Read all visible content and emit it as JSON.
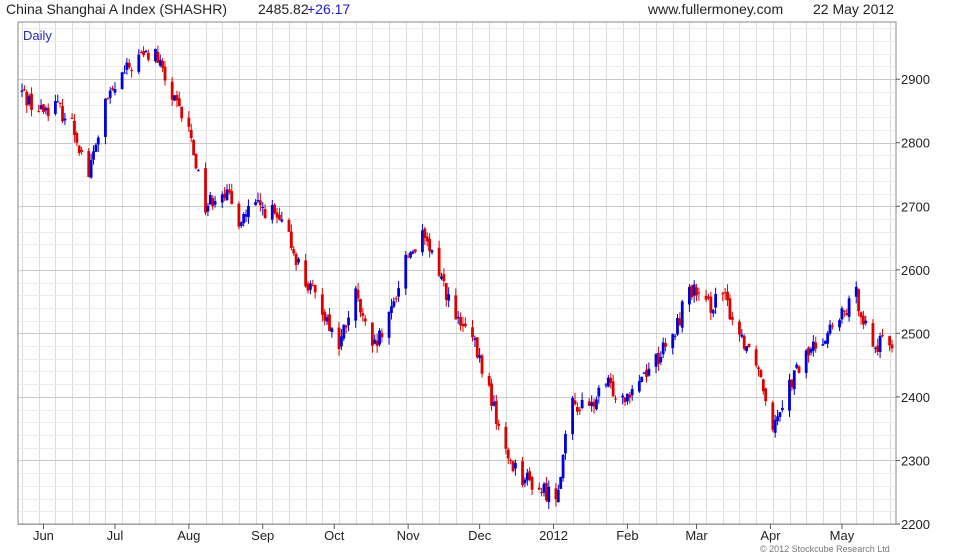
{
  "header": {
    "title": "China Shanghai A Index (SHASHR)",
    "last": "2485.82",
    "change": "+26.17",
    "site": "www.fullermoney.com",
    "date": "22 May 2012"
  },
  "footer": {
    "credit": "© 2012 Stockcube Research Ltd"
  },
  "colors": {
    "up": "#0000dd",
    "down": "#dd0000",
    "grid": "#dcdcdc",
    "frame": "#888888",
    "periodLabel": "#2a2ab0"
  },
  "chart_data": {
    "type": "candlestick",
    "title": "China Shanghai A Index (SHASHR)",
    "period_label": "Daily",
    "xlabel": "",
    "ylabel": "",
    "ylim": [
      2200,
      2990
    ],
    "yticks": [
      2200,
      2300,
      2400,
      2500,
      2600,
      2700,
      2800,
      2900
    ],
    "y_axis_side": "right",
    "grid": true,
    "xlim": [
      "2011-05-23",
      "2012-05-22"
    ],
    "x_ticks": [
      {
        "label": "Jun",
        "date": "2011-06-01"
      },
      {
        "label": "Jul",
        "date": "2011-07-01"
      },
      {
        "label": "Aug",
        "date": "2011-08-01"
      },
      {
        "label": "Sep",
        "date": "2011-09-01"
      },
      {
        "label": "Oct",
        "date": "2011-10-01"
      },
      {
        "label": "Nov",
        "date": "2011-11-01"
      },
      {
        "label": "Dec",
        "date": "2011-12-01"
      },
      {
        "label": "2012",
        "date": "2012-01-01"
      },
      {
        "label": "Feb",
        "date": "2012-02-01"
      },
      {
        "label": "Mar",
        "date": "2012-03-01"
      },
      {
        "label": "Apr",
        "date": "2012-04-01"
      },
      {
        "label": "May",
        "date": "2012-05-01"
      }
    ],
    "close_path": [
      [
        "2011-05-23",
        2880
      ],
      [
        "2011-05-30",
        2850
      ],
      [
        "2011-06-06",
        2860
      ],
      [
        "2011-06-13",
        2830
      ],
      [
        "2011-06-20",
        2750
      ],
      [
        "2011-06-27",
        2860
      ],
      [
        "2011-07-04",
        2905
      ],
      [
        "2011-07-11",
        2935
      ],
      [
        "2011-07-18",
        2940
      ],
      [
        "2011-07-25",
        2870
      ],
      [
        "2011-08-01",
        2820
      ],
      [
        "2011-08-08",
        2700
      ],
      [
        "2011-08-15",
        2730
      ],
      [
        "2011-08-22",
        2680
      ],
      [
        "2011-08-29",
        2700
      ],
      [
        "2011-09-05",
        2690
      ],
      [
        "2011-09-12",
        2650
      ],
      [
        "2011-09-19",
        2580
      ],
      [
        "2011-09-26",
        2540
      ],
      [
        "2011-10-03",
        2480
      ],
      [
        "2011-10-10",
        2560
      ],
      [
        "2011-10-17",
        2470
      ],
      [
        "2011-10-24",
        2520
      ],
      [
        "2011-10-31",
        2620
      ],
      [
        "2011-11-07",
        2650
      ],
      [
        "2011-11-14",
        2600
      ],
      [
        "2011-11-21",
        2520
      ],
      [
        "2011-11-28",
        2490
      ],
      [
        "2011-12-05",
        2410
      ],
      [
        "2011-12-12",
        2310
      ],
      [
        "2011-12-19",
        2275
      ],
      [
        "2011-12-26",
        2255
      ],
      [
        "2012-01-02",
        2245
      ],
      [
        "2012-01-09",
        2390
      ],
      [
        "2012-01-16",
        2380
      ],
      [
        "2012-01-23",
        2420
      ],
      [
        "2012-01-30",
        2400
      ],
      [
        "2012-02-06",
        2430
      ],
      [
        "2012-02-13",
        2460
      ],
      [
        "2012-02-20",
        2490
      ],
      [
        "2012-02-27",
        2575
      ],
      [
        "2012-03-05",
        2540
      ],
      [
        "2012-03-12",
        2560
      ],
      [
        "2012-03-19",
        2500
      ],
      [
        "2012-03-26",
        2460
      ],
      [
        "2012-04-02",
        2360
      ],
      [
        "2012-04-09",
        2420
      ],
      [
        "2012-04-16",
        2465
      ],
      [
        "2012-04-23",
        2495
      ],
      [
        "2012-04-30",
        2520
      ],
      [
        "2012-05-07",
        2560
      ],
      [
        "2012-05-14",
        2480
      ],
      [
        "2012-05-22",
        2486
      ]
    ]
  }
}
